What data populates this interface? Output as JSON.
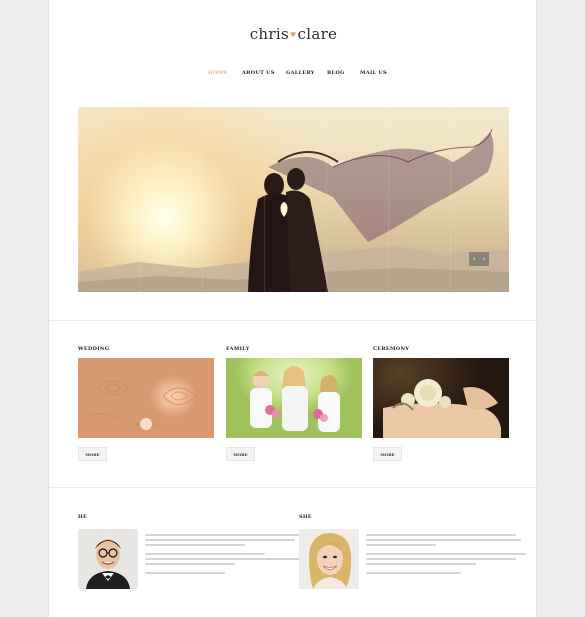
{
  "header": {
    "logo_left": "chris",
    "logo_heart": "♥",
    "logo_right": "clare"
  },
  "nav": {
    "items": [
      {
        "label": "HOME",
        "active": true
      },
      {
        "label": "ABOUT US",
        "active": false
      },
      {
        "label": "GALLERY",
        "active": false
      },
      {
        "label": "BLOG",
        "active": false
      },
      {
        "label": "MAIL US",
        "active": false
      }
    ]
  },
  "slider": {
    "prev_icon": "‹",
    "next_icon": "›"
  },
  "cards": [
    {
      "title": "WEDDING",
      "button": "MORE",
      "image": "roses"
    },
    {
      "title": "FAMILY",
      "button": "MORE",
      "image": "family"
    },
    {
      "title": "CEREMONY",
      "button": "MORE",
      "image": "corsage"
    }
  ],
  "people": [
    {
      "title": "HE",
      "avatar": "groom-portrait"
    },
    {
      "title": "SHE",
      "avatar": "bride-portrait"
    }
  ],
  "colors": {
    "accent": "#e8b77a",
    "text": "#222222",
    "page_bg": "#ffffff",
    "outer_bg": "#ececec"
  }
}
